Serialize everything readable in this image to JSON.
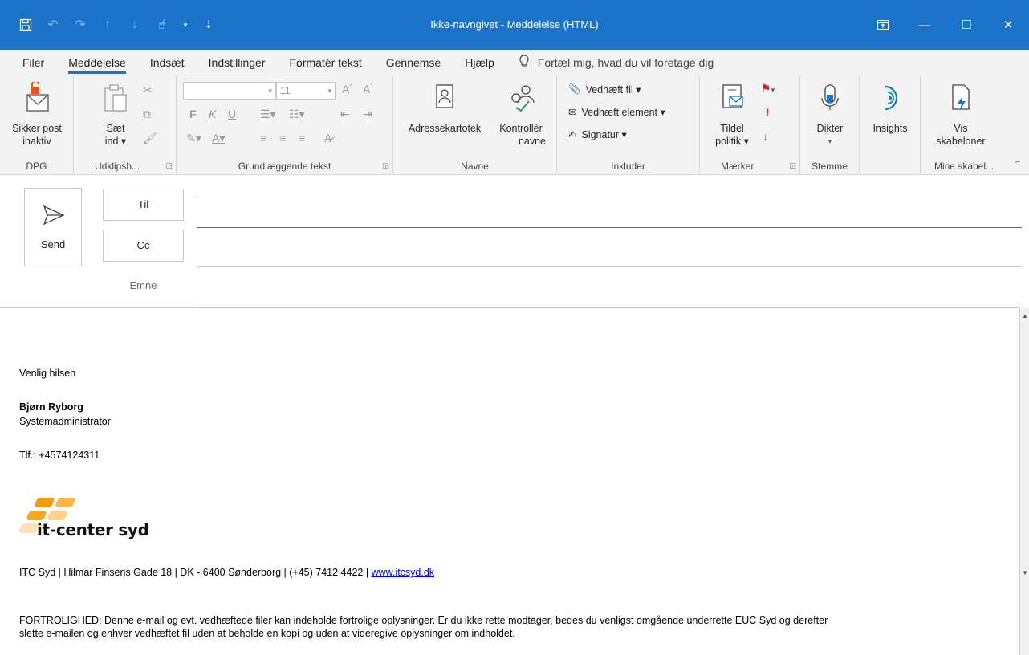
{
  "window": {
    "title": "Ikke-navngivet  -  Meddelelse (HTML)"
  },
  "qat_icons": [
    "save-icon",
    "undo-icon",
    "redo-icon",
    "up-icon",
    "down-icon",
    "touch-mode-icon",
    "customize-icon"
  ],
  "tabs": [
    {
      "label": "Filer"
    },
    {
      "label": "Meddelelse"
    },
    {
      "label": "Indsæt"
    },
    {
      "label": "Indstillinger"
    },
    {
      "label": "Formatér tekst"
    },
    {
      "label": "Gennemse"
    },
    {
      "label": "Hjælp"
    }
  ],
  "tellme": "Fortæl mig, hvad du vil foretage dig",
  "ribbon": {
    "dpg": {
      "button": [
        "Sikker post",
        "inaktiv"
      ],
      "label": "DPG"
    },
    "clipboard": {
      "button": [
        "Sæt",
        "ind ▾"
      ],
      "label": "Udklipsh..."
    },
    "basic_text": {
      "font_size": "11",
      "label": "Grundlæggende tekst"
    },
    "names": {
      "address_book": "Adressekartotek",
      "check_names": [
        "Kontrollér",
        "navne"
      ],
      "label": "Navne"
    },
    "include": {
      "attach_file": "Vedhæft fil ▾",
      "attach_item": "Vedhæft element ▾",
      "signature": "Signatur ▾",
      "label": "Inkluder"
    },
    "tags": {
      "assign_policy": [
        "Tildel",
        "politik ▾"
      ],
      "label": "Mærker"
    },
    "voice": {
      "dictate": "Dikter",
      "label": "Stemme"
    },
    "insights": {
      "label_btn": "Insights"
    },
    "templates": {
      "view": [
        "Vis",
        "skabeloner"
      ],
      "label": "Mine skabel..."
    }
  },
  "compose": {
    "send": "Send",
    "to": "Til",
    "cc": "Cc",
    "subject": "Emne"
  },
  "signature": {
    "greeting": "Venlig hilsen",
    "name": "Bjørn Ryborg",
    "role": "Systemadministrator",
    "phone": "Tlf.: +4574124311",
    "logo_text": "it-center syd",
    "address": "ITC Syd | Hilmar Finsens Gade 18  | DK - 6400  Sønderborg  |  (+45) 7412 4422  |",
    "website": "www.itcsyd.dk",
    "disclaimer_1": "FORTROLIGHED: Denne e-mail og evt. vedhæftede filer kan indeholde fortrolige oplysninger. Er du ikke rette modtager, bedes du venligst omgående underrette EUC Syd og derefter",
    "disclaimer_2": "slette e-mailen og enhver vedhæftet fil uden at beholde en kopi og uden at videregive oplysninger om indholdet."
  },
  "colors": {
    "accent": "#1a73c8",
    "link": "#0000ee",
    "logo_orange": "#f5a623"
  }
}
